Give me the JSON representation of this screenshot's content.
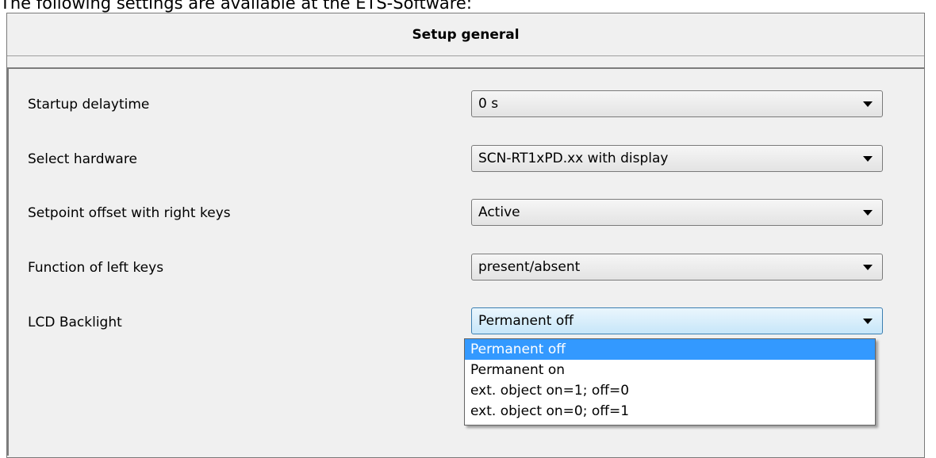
{
  "intro_text": "The following settings are available at the ETS-Software:",
  "header": {
    "title": "Setup general"
  },
  "rows": [
    {
      "label": "Startup delaytime",
      "value": "0 s"
    },
    {
      "label": "Select hardware",
      "value": "SCN-RT1xPD.xx with display"
    },
    {
      "label": "Setpoint offset with right keys",
      "value": "Active"
    },
    {
      "label": "Function of left keys",
      "value": "present/absent"
    },
    {
      "label": "LCD Backlight",
      "value": "Permanent off"
    }
  ],
  "dropdown": {
    "options": [
      "Permanent off",
      "Permanent on",
      "ext. object on=1; off=0",
      "ext. object on=0; off=1"
    ],
    "selected": "Permanent off"
  },
  "colors": {
    "selection": "#3399ff",
    "panel_background": "#f0f0f0",
    "active_select_border": "#3c7fb1"
  },
  "icons": {
    "dropdown_arrow": "chevron-down-icon"
  }
}
